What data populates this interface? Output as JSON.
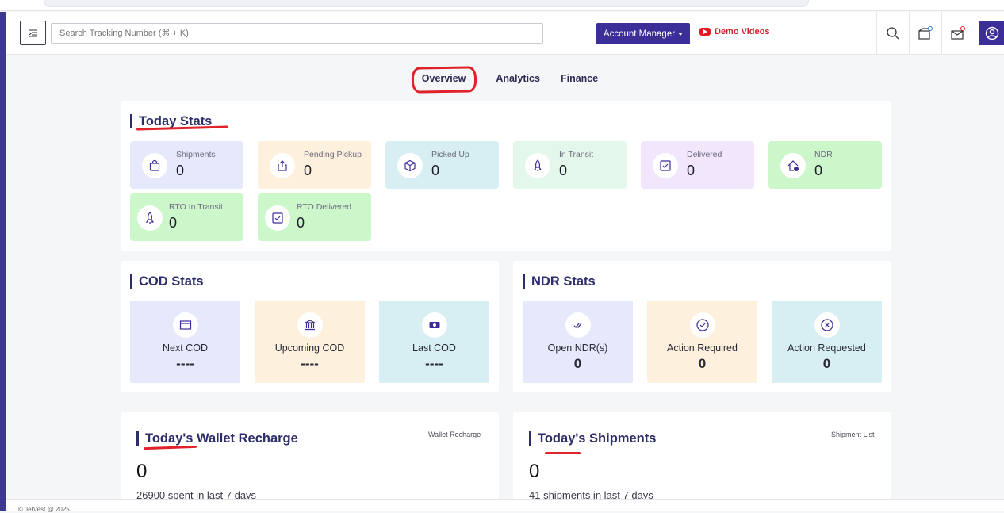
{
  "search": {
    "placeholder": "Search Tracking Number (⌘ + K)"
  },
  "header": {
    "account_manager": "Account Manager",
    "demo_videos": "Demo Videos"
  },
  "tabs": [
    {
      "label": "Overview",
      "active": true
    },
    {
      "label": "Analytics"
    },
    {
      "label": "Finance"
    }
  ],
  "today_stats": {
    "title": "Today Stats",
    "items": [
      {
        "label": "Shipments",
        "value": "0",
        "color": "#e6e8fb",
        "icon": "bag-icon"
      },
      {
        "label": "Pending Pickup",
        "value": "0",
        "color": "#fdf0dc",
        "icon": "upload-icon"
      },
      {
        "label": "Picked Up",
        "value": "0",
        "color": "#d7eff3",
        "icon": "box-icon"
      },
      {
        "label": "In Transit",
        "value": "0",
        "color": "#e3f8ea",
        "icon": "rocket-icon"
      },
      {
        "label": "Delivered",
        "value": "0",
        "color": "#f1e6fb",
        "icon": "checkbox-icon"
      },
      {
        "label": "NDR",
        "value": "0",
        "color": "#ccf7cb",
        "icon": "home-alert-icon"
      },
      {
        "label": "RTO In Transit",
        "value": "0",
        "color": "#ccf7cb",
        "icon": "rocket-icon"
      },
      {
        "label": "RTO Delivered",
        "value": "0",
        "color": "#ccf7cb",
        "icon": "checkbox-icon"
      }
    ]
  },
  "cod_stats": {
    "title": "COD Stats",
    "items": [
      {
        "label": "Next COD",
        "value": "----",
        "color": "#e6e8fb",
        "icon": "card-icon"
      },
      {
        "label": "Upcoming COD",
        "value": "----",
        "color": "#fdf0dc",
        "icon": "bank-icon"
      },
      {
        "label": "Last COD",
        "value": "----",
        "color": "#d7eff3",
        "icon": "cash-icon"
      }
    ]
  },
  "ndr_stats": {
    "title": "NDR Stats",
    "items": [
      {
        "label": "Open NDR(s)",
        "value": "0",
        "color": "#e6e8fb",
        "icon": "double-check-icon"
      },
      {
        "label": "Action Required",
        "value": "0",
        "color": "#fdf0dc",
        "icon": "check-circle-icon"
      },
      {
        "label": "Action Requested",
        "value": "0",
        "color": "#d7eff3",
        "icon": "x-circle-icon"
      }
    ]
  },
  "wallet": {
    "title": "Today's Wallet Recharge",
    "link": "Wallet Recharge",
    "value": "0",
    "sub": "26900 spent in last 7 days"
  },
  "shipments": {
    "title": "Today's Shipments",
    "link": "Shipment List",
    "value": "0",
    "sub": "41 shipments in last 7 days"
  },
  "footer": {
    "text": "© JetVest @ 2025"
  },
  "colors": {
    "brand": "#3b2e98",
    "annotation": "#e0222a"
  }
}
